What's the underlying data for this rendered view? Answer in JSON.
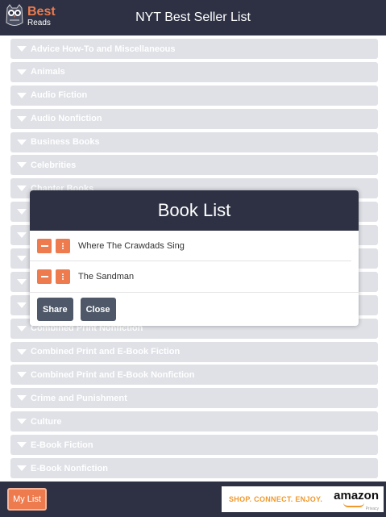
{
  "header": {
    "logo_best": "Best",
    "logo_reads": "Reads",
    "title": "NYT Best Seller List"
  },
  "categories": [
    "Advice How-To and Miscellaneous",
    "Animals",
    "Audio Fiction",
    "Audio Nonfiction",
    "Business Books",
    "Celebrities",
    "Chapter Books",
    "",
    "",
    "",
    "",
    "",
    "Combined Print Nonfiction",
    "Combined Print and E-Book Fiction",
    "Combined Print and E-Book Nonfiction",
    "Crime and Punishment",
    "Culture",
    "E-Book Fiction",
    "E-Book Nonfiction"
  ],
  "modal": {
    "title": "Book List",
    "books": [
      "Where The Crawdads Sing",
      "The Sandman"
    ],
    "share_label": "Share",
    "close_label": "Close"
  },
  "footer": {
    "mylist_label": "My List",
    "ad_tagline": "SHOP. CONNECT. ENJOY.",
    "ad_brand": "amazon",
    "ad_privacy": "Privacy"
  },
  "colors": {
    "navy": "#2d3143",
    "accent": "#ee7b4e",
    "category_bg": "#dfe1e6",
    "button": "#4e5868"
  }
}
